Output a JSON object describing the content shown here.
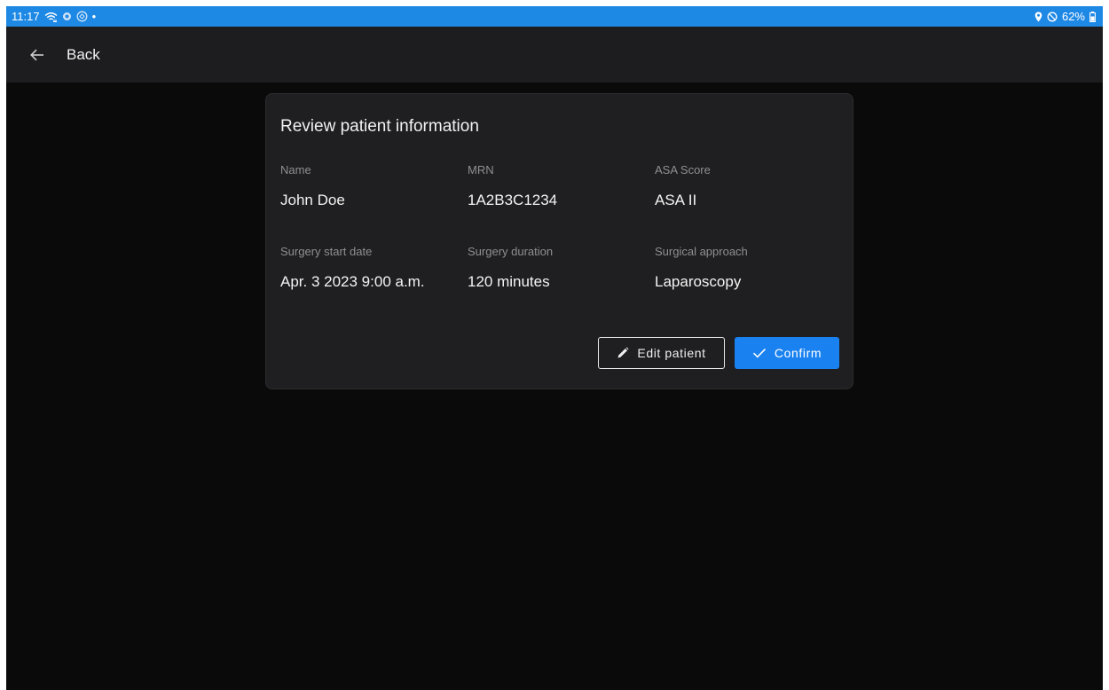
{
  "status_bar": {
    "time": "11:17",
    "battery": "62%",
    "left_icons": [
      "wifi-icon",
      "circle-notification-icon",
      "sync-notification-icon"
    ],
    "right_icons": [
      "location-pin-icon",
      "do-not-disturb-icon",
      "battery-icon"
    ],
    "color": "#1e88e5"
  },
  "app_bar": {
    "back_label": "Back"
  },
  "card": {
    "title": "Review patient information",
    "fields": {
      "name": {
        "label": "Name",
        "value": "John Doe"
      },
      "mrn": {
        "label": "MRN",
        "value": "1A2B3C1234"
      },
      "asa": {
        "label": "ASA Score",
        "value": "ASA II"
      },
      "start": {
        "label": "Surgery start date",
        "value": "Apr. 3 2023 9:00 a.m."
      },
      "duration": {
        "label": "Surgery duration",
        "value": "120 minutes"
      },
      "approach": {
        "label": "Surgical approach",
        "value": "Laparoscopy"
      }
    },
    "buttons": {
      "edit_label": "Edit patient",
      "edit_icon": "pencil-icon",
      "confirm_label": "Confirm",
      "confirm_icon": "checkmark-icon",
      "confirm_color": "#1a82f0"
    }
  }
}
